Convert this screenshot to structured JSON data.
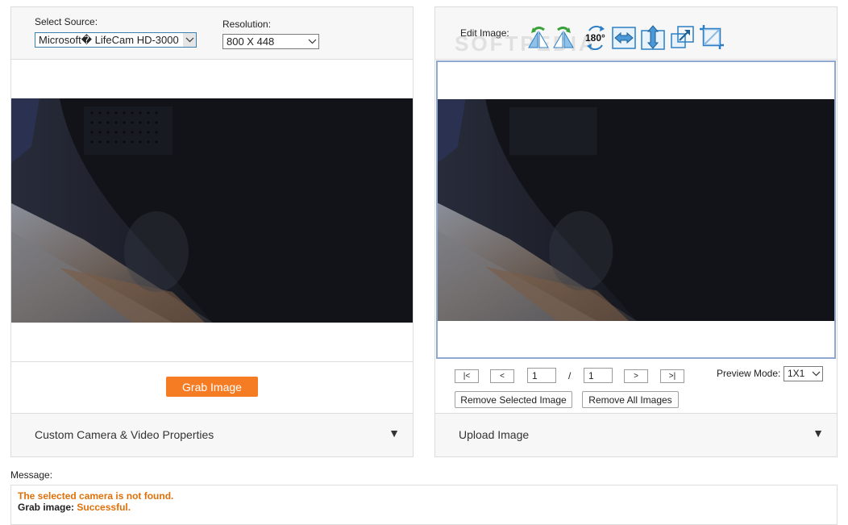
{
  "left_panel": {
    "source_label": "Select Source:",
    "source_value": "Microsoft� LifeCam HD-3000",
    "resolution_label": "Resolution:",
    "resolution_value": "800 X 448",
    "grab_button": "Grab Image",
    "footer_label": "Custom Camera & Video Properties",
    "footer_arrow": "▼"
  },
  "right_panel": {
    "edit_label": "Edit Image:",
    "watermark": "SOFTPEDIA",
    "tools": [
      {
        "icon": "flip-horizontal-left-icon"
      },
      {
        "icon": "flip-horizontal-right-icon"
      },
      {
        "icon": "rotate-180-icon",
        "text": "180°"
      },
      {
        "icon": "mirror-horizontal-icon"
      },
      {
        "icon": "mirror-vertical-icon"
      },
      {
        "icon": "resize-icon"
      },
      {
        "icon": "crop-icon"
      }
    ],
    "nav": {
      "first": "|<",
      "prev": "<",
      "current_page": "1",
      "separator": "/",
      "total_pages": "1",
      "next": ">",
      "last": ">|"
    },
    "preview_mode_label": "Preview Mode:",
    "preview_mode_value": "1X1",
    "remove_selected": "Remove Selected Image",
    "remove_all": "Remove All Images",
    "footer_label": "Upload Image",
    "footer_arrow": "▼"
  },
  "message": {
    "label": "Message:",
    "line1": "The selected camera is not found.",
    "line2_label": "Grab image:",
    "line2_value": "Successful."
  },
  "colors": {
    "accent_orange": "#f57c22",
    "message_orange": "#e0700a",
    "selection_border": "#8fa8cf",
    "icon_blue": "#2c7fc4",
    "icon_green": "#3aa23a"
  }
}
